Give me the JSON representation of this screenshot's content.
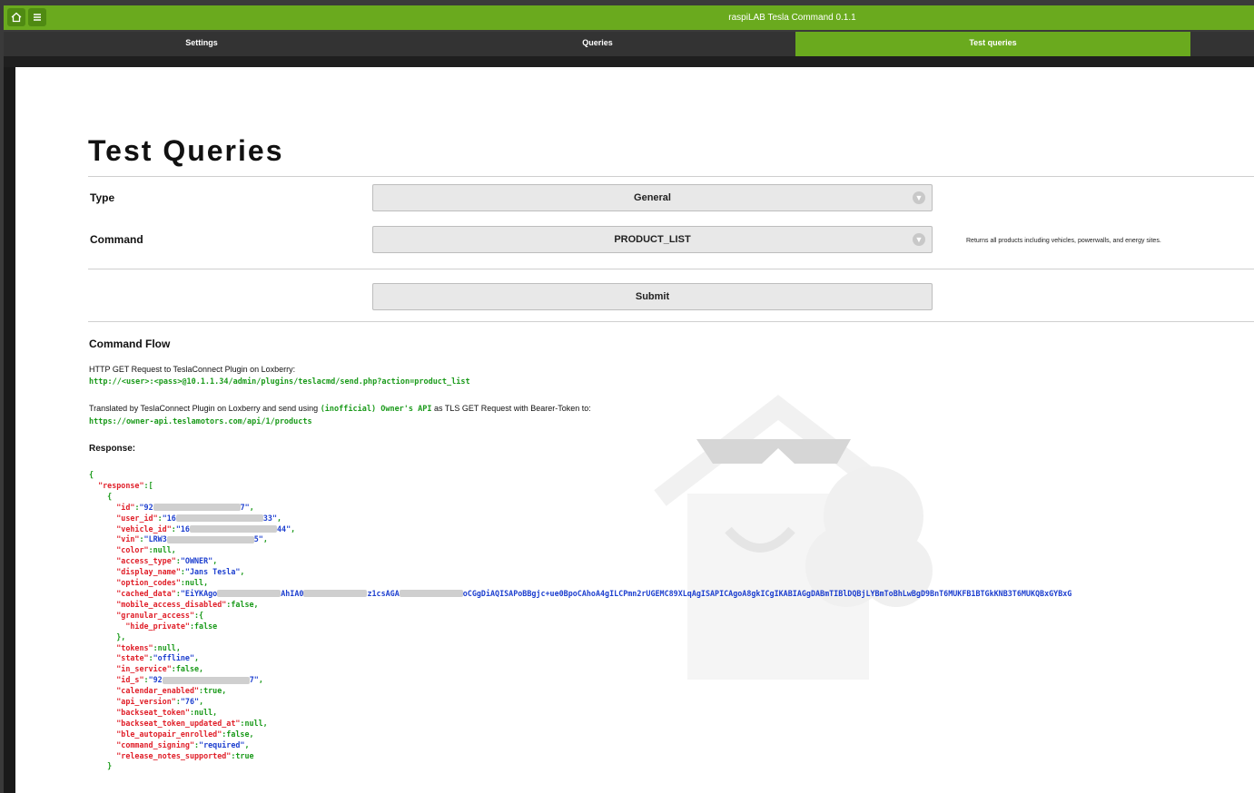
{
  "app": {
    "title": "raspiLAB Tesla Command 0.1.1",
    "home_icon": "home-icon",
    "menu_icon": "menu-icon"
  },
  "tabs": [
    {
      "label": "Settings"
    },
    {
      "label": "Queries"
    },
    {
      "label": "Test queries",
      "active": true
    }
  ],
  "colors": {
    "accent": "#6aaa1e",
    "json_key": "#e0202a",
    "json_string": "#1d3fcf",
    "json_plain": "#1a9a1a"
  },
  "page": {
    "title": "Test Queries"
  },
  "form": {
    "type_label": "Type",
    "type_value": "General",
    "command_label": "Command",
    "command_value": "PRODUCT_LIST",
    "command_hint": "Returns all products including vehicles, powerwalls, and energy sites.",
    "submit_label": "Submit"
  },
  "flow": {
    "title": "Command Flow",
    "request_intro": "HTTP GET Request to TeslaConnect Plugin on Loxberry:",
    "request_url": "http://<user>:<pass>@10.1.1.34/admin/plugins/teslacmd/send.php?action=product_list",
    "translated_pre": "Translated by TeslaConnect Plugin on Loxberry and send using",
    "translated_api": "(inofficial) Owner's API",
    "translated_post": "as TLS GET Request with Bearer-Token to:",
    "api_url": "https://owner-api.teslamotors.com/api/1/products",
    "response_title": "Response:"
  },
  "response": {
    "id_prefix": "92",
    "id_suffix": "7",
    "user_id_prefix": "16",
    "user_id_suffix": "33",
    "vehicle_id_prefix": "16",
    "vehicle_id_suffix": "44",
    "vin_prefix": "LRW3",
    "vin_suffix": "5",
    "color": "null",
    "access_type": "OWNER",
    "display_name": "Jans Tesla",
    "option_codes": "null",
    "cached_data_part1": "EiYKAgo",
    "cached_data_part2": "AhIA0",
    "cached_data_part3": "z1csAGA",
    "cached_data_part4": "oCGgDiAQISAPoBBgjc+ue0BpoCAhoA4gILCPmn2rUGEMC89XLqAgISAPICAgoA8gkICgIKABIAGgDABmTIBlDQBjLYBmToBhLwBgD9BnT6MUKFB1BTGkKNB3T6MUKQBxGYBxG",
    "mobile_access_disabled": "false",
    "hide_private": "false",
    "tokens": "null",
    "state": "offline",
    "in_service": "false",
    "id_s_prefix": "92",
    "id_s_suffix": "7",
    "calendar_enabled": "true",
    "api_version": "76",
    "backseat_token": "null",
    "backseat_token_updated_at": "null",
    "ble_autopair_enrolled": "false",
    "command_signing": "required",
    "release_notes_supported": "true"
  }
}
